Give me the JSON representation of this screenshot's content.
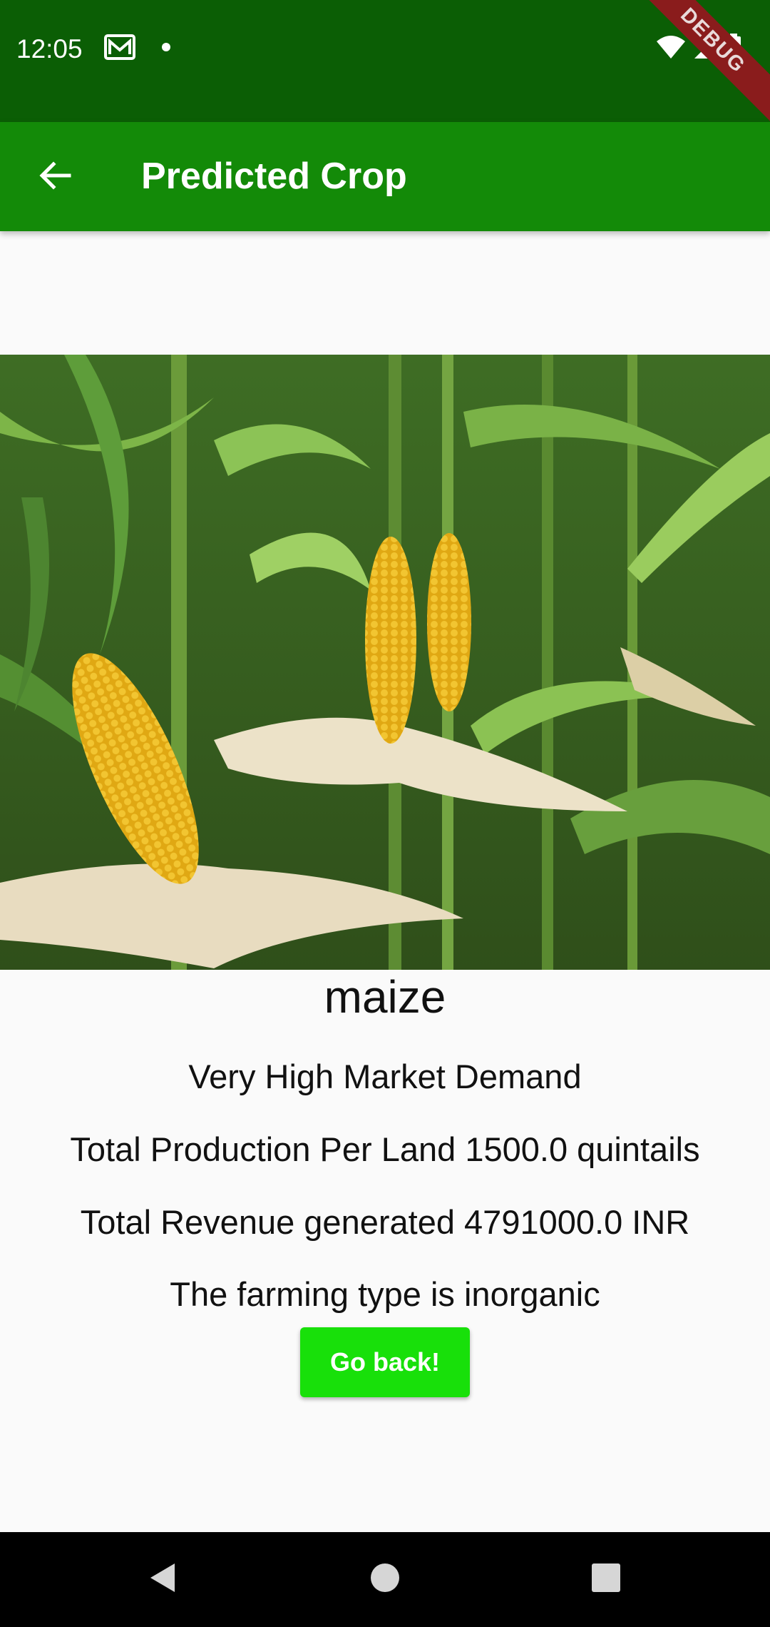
{
  "status_bar": {
    "time": "12:05",
    "icons_left": [
      "gmail-icon",
      "notification-dot-icon"
    ],
    "icons_right": [
      "wifi-icon",
      "signal-icon",
      "battery-icon"
    ],
    "debug_banner": "DEBUG",
    "background": "#0b5e05"
  },
  "app_bar": {
    "title": "Predicted Crop",
    "back_icon": "arrow-back-icon",
    "background": "#138a08"
  },
  "result": {
    "crop_name": "maize",
    "market_demand": "Very High Market Demand",
    "production": "Total Production Per Land 1500.0 quintails",
    "revenue": "Total Revenue generated 4791000.0 INR",
    "farming_type": "The farming type is inorganic"
  },
  "actions": {
    "go_back_label": "Go back!",
    "button_color": "#18e00a"
  },
  "nav_bar": {
    "icons": [
      "back-triangle-icon",
      "home-circle-icon",
      "recents-square-icon"
    ]
  }
}
